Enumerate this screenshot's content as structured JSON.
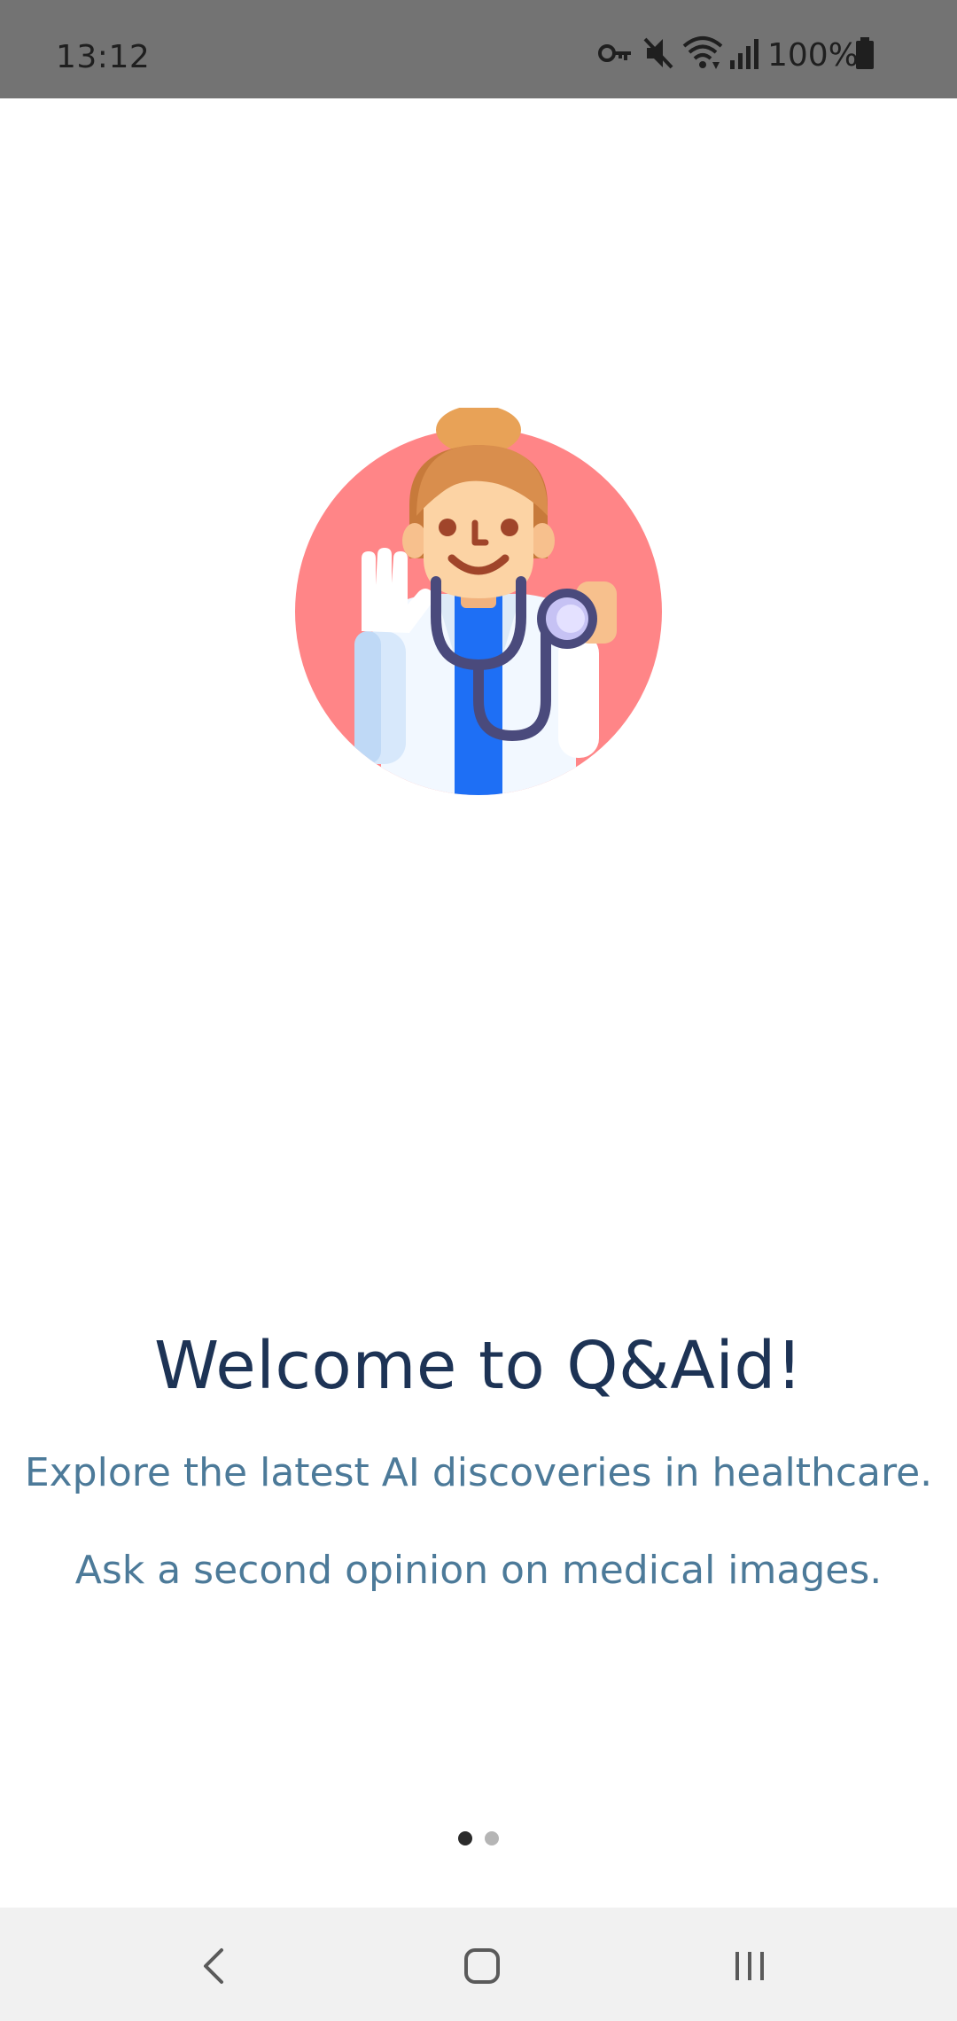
{
  "status_bar": {
    "time": "13:12",
    "battery_text": "100%",
    "icons": [
      "vpn-key-icon",
      "mute-icon",
      "wifi-icon",
      "signal-icon",
      "battery-icon"
    ]
  },
  "onboarding": {
    "illustration": "doctor-illustration",
    "title": "Welcome to Q&Aid!",
    "line1": "Explore the latest AI discoveries in healthcare.",
    "line2": "Ask a second opinion on medical images.",
    "page_indicator": {
      "total_pages": 2,
      "current_page": 1
    }
  },
  "nav_bar": {
    "buttons": [
      "back-icon",
      "home-icon",
      "recents-icon"
    ]
  },
  "colors": {
    "status_bar": "#737373",
    "title": "#1d3355",
    "subtitle": "#4c7a99",
    "circle": "#ff8587",
    "coat_blue": "#1e6ff5"
  }
}
